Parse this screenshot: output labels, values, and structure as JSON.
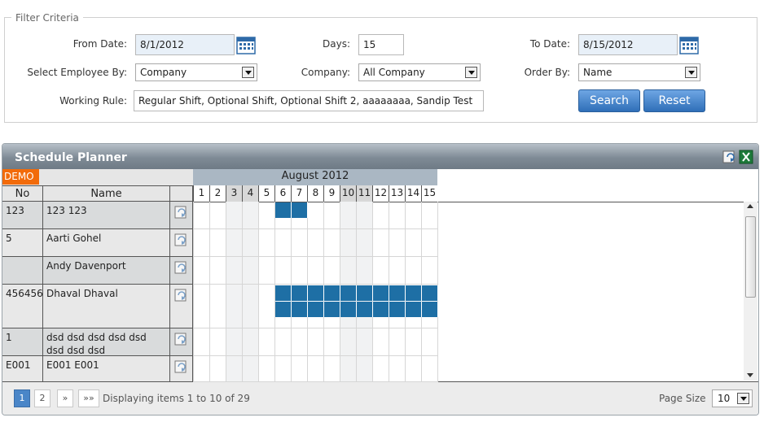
{
  "filter": {
    "legend": "Filter Criteria",
    "from_date_label": "From Date:",
    "from_date": "8/1/2012",
    "days_label": "Days:",
    "days": "15",
    "to_date_label": "To Date:",
    "to_date": "8/15/2012",
    "select_employee_label": "Select Employee By:",
    "select_employee_value": "Company",
    "company_label": "Company:",
    "company_value": "All Company",
    "order_by_label": "Order By:",
    "order_by_value": "Name",
    "working_rule_label": "Working Rule:",
    "working_rule_value": "Regular Shift, Optional Shift, Optional Shift 2, aaaaaaaa, Sandip Test",
    "search_label": "Search",
    "reset_label": "Reset"
  },
  "planner": {
    "title": "Schedule Planner",
    "demo_badge": "DEMO",
    "col_no": "No",
    "col_name": "Name",
    "month": "August 2012",
    "days": [
      "1",
      "2",
      "3",
      "4",
      "5",
      "6",
      "7",
      "8",
      "9",
      "10",
      "11",
      "12",
      "13",
      "14",
      "15"
    ],
    "rows": [
      {
        "no": "123",
        "name": "123 123"
      },
      {
        "no": "5",
        "name": "Aarti Gohel"
      },
      {
        "no": "",
        "name": "Andy Davenport"
      },
      {
        "no": "456456",
        "name": "Dhaval Dhaval"
      },
      {
        "no": "1",
        "name": "dsd dsd dsd dsd dsd dsd dsd dsd"
      },
      {
        "no": "E001",
        "name": "E001 E001"
      }
    ]
  },
  "footer": {
    "page_1": "1",
    "page_2": "2",
    "next": "»",
    "last": "»»",
    "display_text": "Displaying items 1 to 10 of 29",
    "page_size_label": "Page Size",
    "page_size_value": "10"
  },
  "colors": {
    "accent": "#1e6fa5",
    "demo": "#f26b0a",
    "button": "#2f6fb8"
  }
}
